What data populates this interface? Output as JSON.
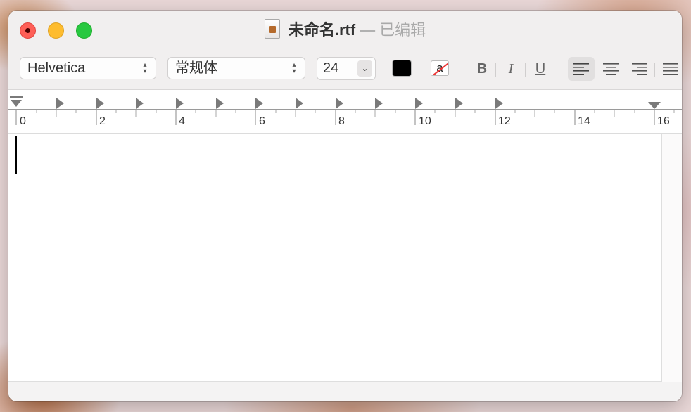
{
  "window": {
    "title": "未命名.rtf",
    "title_separator": "—",
    "title_status": "已编辑"
  },
  "toolbar": {
    "font_family": "Helvetica",
    "font_style": "常规体",
    "font_size": "24",
    "text_color": "#000000",
    "highlight_glyph": "a",
    "bold_label": "B",
    "italic_label": "I",
    "underline_label": "U",
    "alignment_selected": "left"
  },
  "ruler": {
    "labels": [
      "0",
      "2",
      "4",
      "6",
      "8",
      "10",
      "12",
      "14",
      "16"
    ]
  },
  "document": {
    "text": ""
  }
}
